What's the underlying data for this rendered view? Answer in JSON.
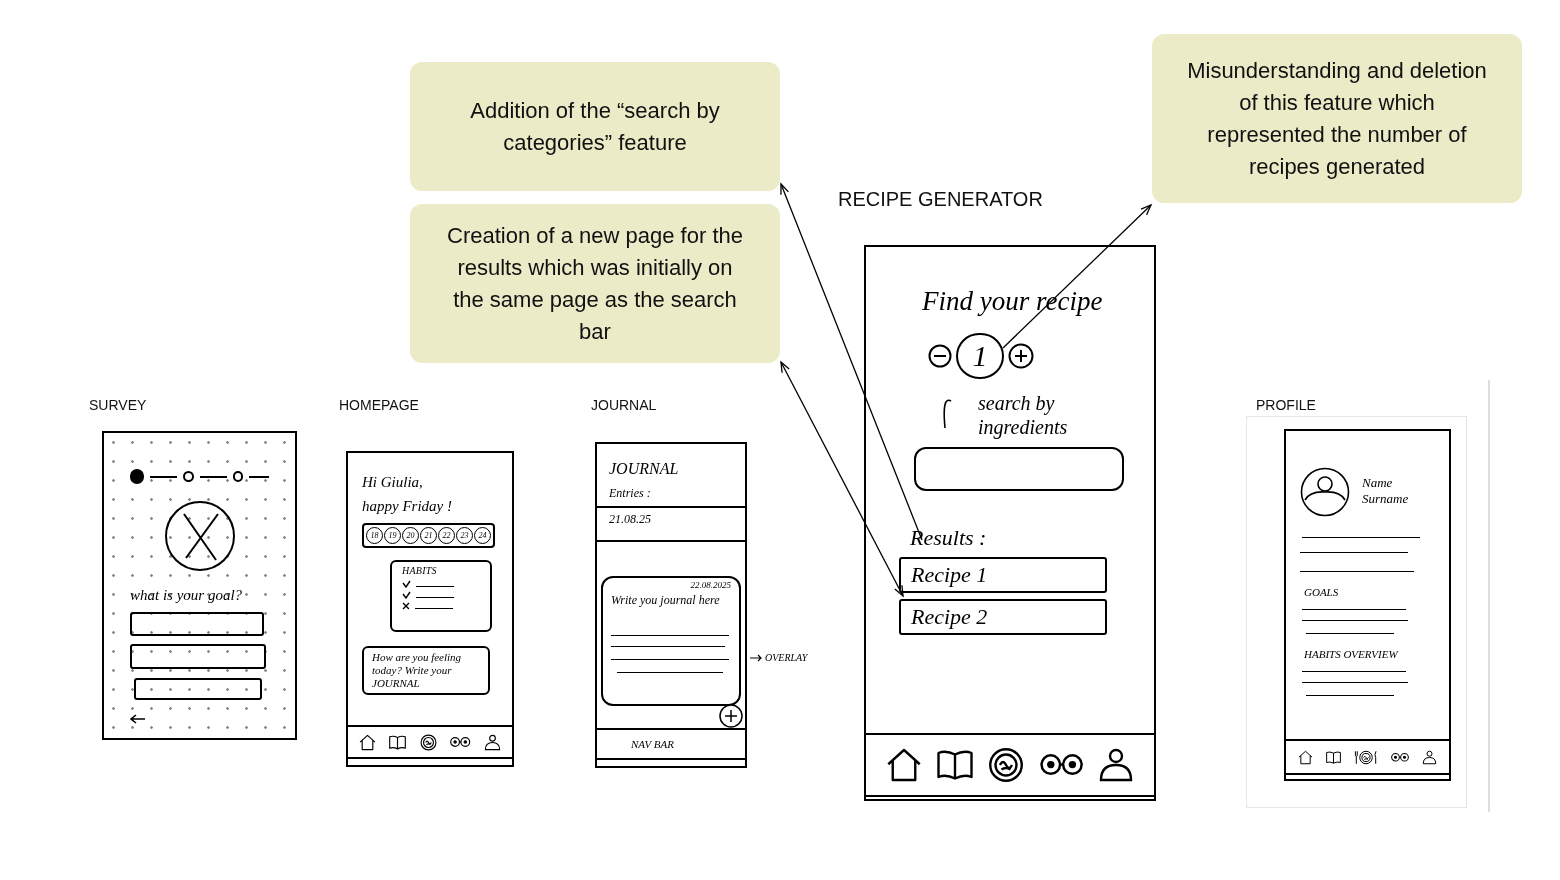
{
  "callouts": [
    {
      "text": "Addition of the “search by categories” feature"
    },
    {
      "text": "Creation of a new page for the results which was initially on the same page as the search bar"
    },
    {
      "text": "Misunderstanding and deletion of this feature which represented the number of recipes generated"
    }
  ],
  "survey": {
    "label": "SURVEY",
    "steps": [
      {
        "done": true
      },
      {
        "done": false
      },
      {
        "done": false
      }
    ],
    "question": "what is your goal?"
  },
  "homepage": {
    "label": "HOMEPAGE",
    "greeting": "Hi Giulia,",
    "subtitle": "happy Friday !",
    "days": [
      "18",
      "19",
      "20",
      "21",
      "22",
      "23",
      "24"
    ],
    "habits": {
      "title": "HABITS",
      "items": [
        {
          "done": true
        },
        {
          "done": true
        },
        {
          "done": false
        }
      ]
    },
    "journal_prompt": "How are you feeling today? Write your JOURNAL"
  },
  "journal": {
    "label": "JOURNAL",
    "title": "JOURNAL",
    "entries_label": "Entries :",
    "entries": [
      "21.08.25"
    ],
    "overlay": {
      "date": "22.08.2025",
      "placeholder": "Write you journal here"
    },
    "nav_label": "NAV BAR",
    "annotation": "OVERLAY"
  },
  "recipe_generator": {
    "label": "RECIPE GENERATOR",
    "title": "Find your recipe",
    "count": "1",
    "search_label": "search by ingredients",
    "results_label": "Results :",
    "results": [
      "Recipe 1",
      "Recipe 2"
    ]
  },
  "profile": {
    "label": "PROFILE",
    "name": "Name Surname",
    "sections": [
      "GOALS",
      "HABITS OVERVIEW"
    ]
  }
}
